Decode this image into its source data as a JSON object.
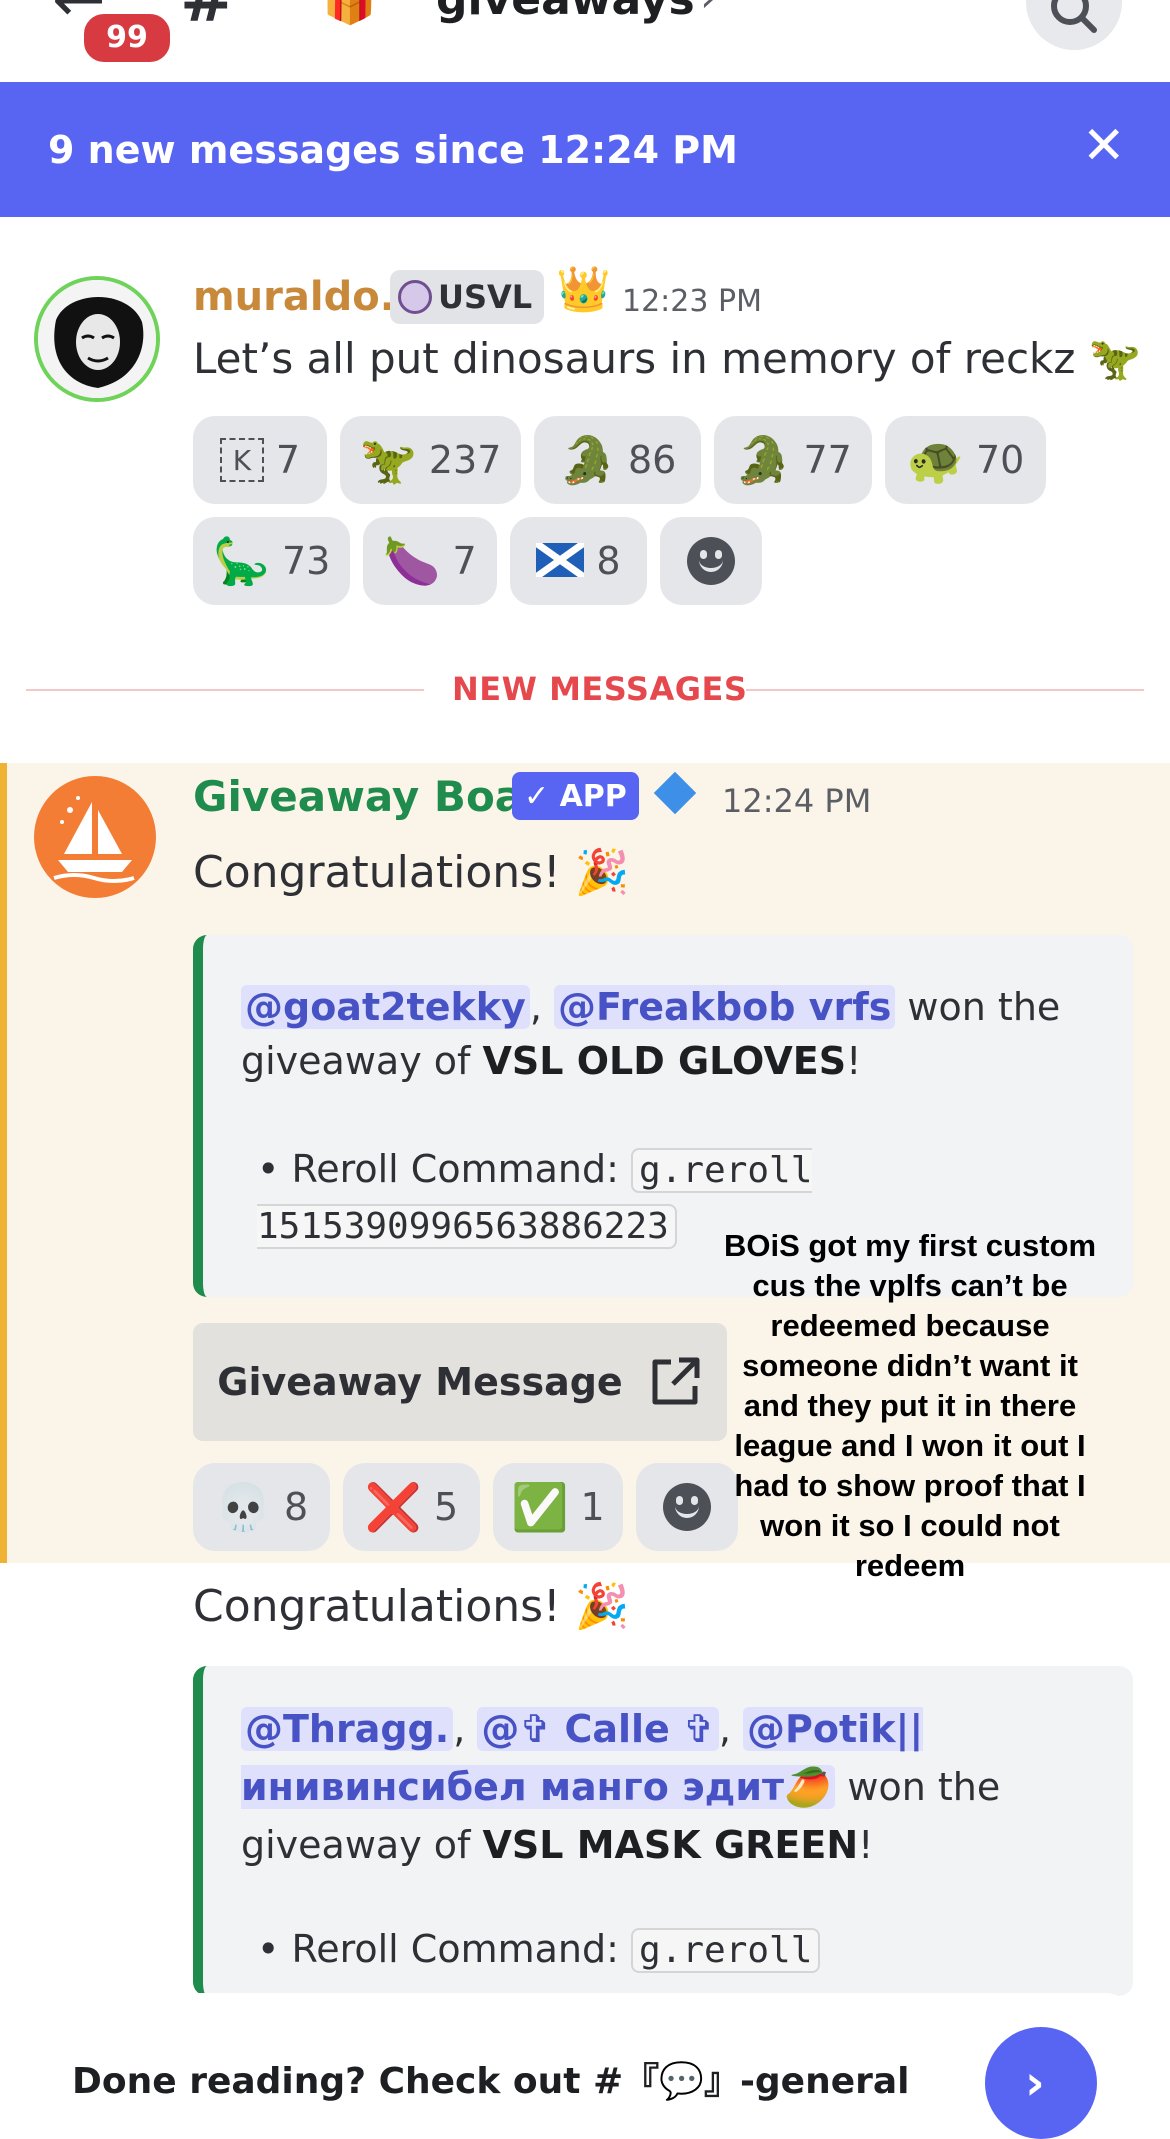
{
  "header": {
    "unread_count": "99",
    "channel_name": "giveaways",
    "channel_icon_emoji": "🎁"
  },
  "banner": {
    "text": "9 new messages since 12:24 PM"
  },
  "message1": {
    "author": "muraldo.",
    "role_tag": "USVL",
    "crown_emoji": "👑",
    "time": "12:23 PM",
    "text": "Let’s all put dinosaurs in memory of reckz 🦖",
    "reactions": [
      {
        "emoji": "K",
        "count": "7"
      },
      {
        "emoji": "🦖",
        "count": "237"
      },
      {
        "emoji": "🐊",
        "count": "86"
      },
      {
        "emoji": "🐊",
        "count": "77"
      },
      {
        "emoji": "🐢",
        "count": "70"
      },
      {
        "emoji": "🦕",
        "count": "73"
      },
      {
        "emoji": "🍆",
        "count": "7"
      },
      {
        "emoji": "🏴",
        "count": "8"
      }
    ]
  },
  "divider": {
    "label": "NEW MESSAGES"
  },
  "message2": {
    "author": "Giveaway Boat",
    "app_tag": "✓ APP",
    "time": "12:24 PM",
    "congrats": "Congratulations! 🎉",
    "embed": {
      "mention1": "@goat2tekky",
      "mention2": "@Freakbob vrfs",
      "won_text": " won the giveaway of ",
      "prize": "VSL OLD GLOVES",
      "reroll_label": "• Reroll Command: ",
      "reroll_code": "g.reroll 1515390996563886223"
    },
    "button_label": "Giveaway Message",
    "reactions": [
      {
        "emoji": "💀",
        "count": "8"
      },
      {
        "emoji": "❌",
        "count": "5"
      },
      {
        "emoji": "✅",
        "count": "1"
      }
    ]
  },
  "message3": {
    "congrats": "Congratulations! 🎉",
    "embed": {
      "mention1": "@Thragg.",
      "mention2": "@✞ Calle ✞",
      "mention3": "@Potik||инивинсибел манго эдит🥭",
      "won_text": " won the giveaway of ",
      "prize": "VSL MASK GREEN",
      "reroll_label": "• Reroll Command: ",
      "reroll_code": "g.reroll"
    }
  },
  "overlay_caption": "BOiS got my first custom cus the vplfs can’t be redeemed because someone didn’t want it and they put it in there league and I won it out I had to show proof that I won it so I could not redeem",
  "footer": {
    "text": "Done reading? Check out #『💬』-general"
  },
  "colors": {
    "accent": "#5865f2",
    "new_messages_red": "#e5484d",
    "giveaway_green": "#1f8b4c",
    "highlight_bg": "#fbf5e9",
    "highlight_bar": "#f0b232",
    "author1_gold": "#c9893a"
  }
}
